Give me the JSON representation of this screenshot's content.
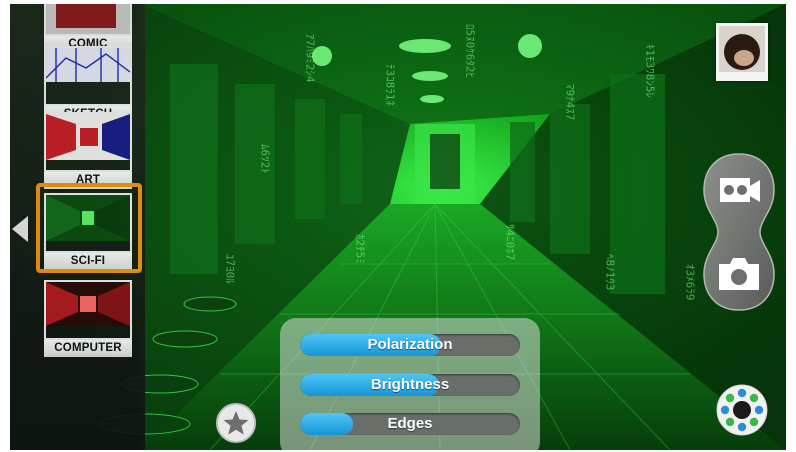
{
  "filters": [
    {
      "id": "comic",
      "label": "COMIC",
      "selected": false
    },
    {
      "id": "sketch",
      "label": "SKETCH",
      "selected": false
    },
    {
      "id": "art",
      "label": "ART",
      "selected": false
    },
    {
      "id": "scifi",
      "label": "SCI-FI",
      "selected": true
    },
    {
      "id": "computer",
      "label": "COMPUTER",
      "selected": false
    }
  ],
  "sliders": [
    {
      "label": "Polarization",
      "level": 0.64
    },
    {
      "label": "Brightness",
      "level": 0.63
    },
    {
      "label": "Edges",
      "level": 0.24
    }
  ],
  "icons": {
    "strip_collapse": "left-arrow-icon",
    "video_mode": "video-camera-icon",
    "photo_mode": "camera-icon",
    "effects": "dots-ring-icon",
    "favorite": "star-icon",
    "gallery": "gallery-thumbnail"
  },
  "colors": {
    "selection_border": "#f0920d",
    "slider_fill": "#1fa3e3",
    "effects_dots": [
      "#2a8dd6",
      "#3cb54a"
    ]
  }
}
